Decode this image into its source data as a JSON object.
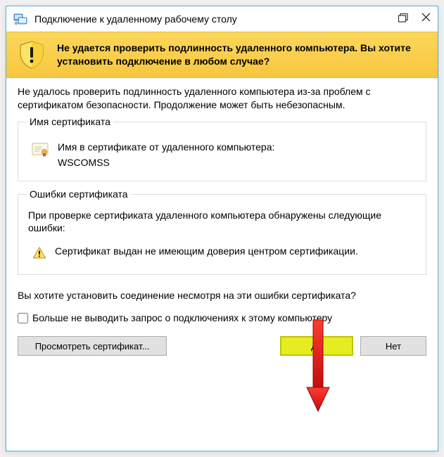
{
  "titlebar": {
    "title": "Подключение к удаленному рабочему столу"
  },
  "banner": {
    "text": "Не удается проверить подлинность удаленного компьютера. Вы хотите установить подключение в любом случае?"
  },
  "intro": "Не удалось проверить подлинность удаленного компьютера из-за проблем с сертификатом безопасности. Продолжение может быть небезопасным.",
  "cert_group": {
    "legend": "Имя сертификата",
    "label": "Имя в сертификате от удаленного компьютера:",
    "name": "WSCOMSS"
  },
  "errors_group": {
    "legend": "Ошибки сертификата",
    "intro": "При проверке сертификата удаленного компьютера обнаружены следующие ошибки:",
    "item": "Сертификат выдан не имеющим доверия центром сертификации."
  },
  "confirm_question": "Вы хотите установить соединение несмотря на эти ошибки сертификата?",
  "checkbox_label": "Больше не выводить запрос о подключениях к этому компьютеру",
  "buttons": {
    "view": "Просмотреть сертификат...",
    "yes": "Да",
    "no": "Нет"
  }
}
